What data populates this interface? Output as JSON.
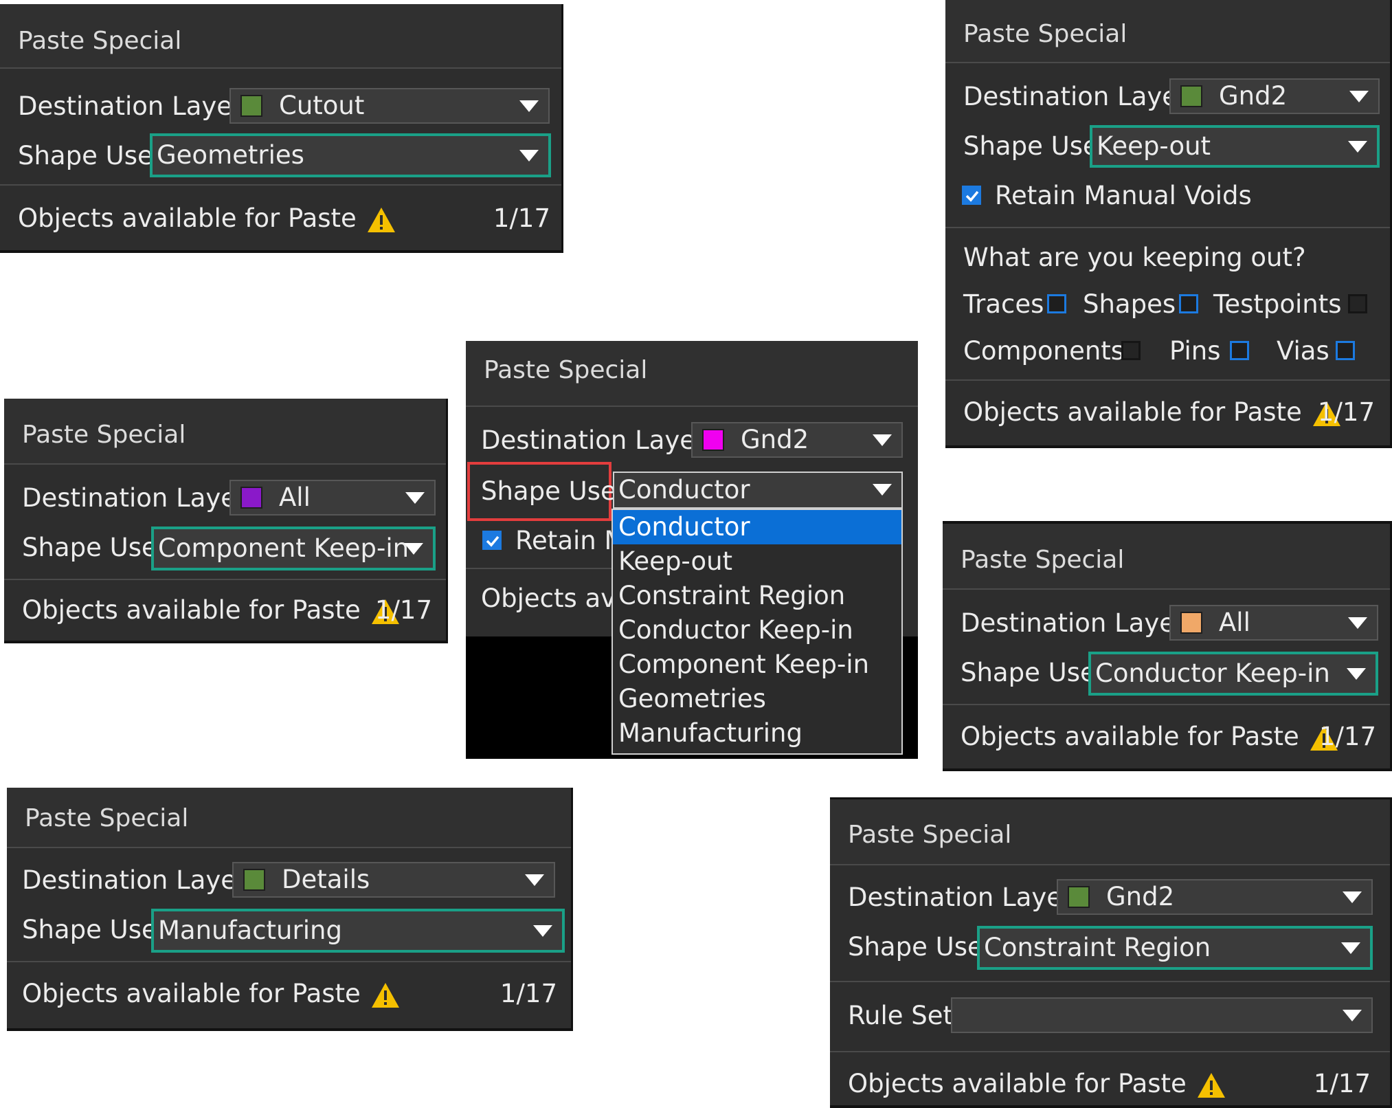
{
  "colors": {
    "highlight_border": "#1aa087",
    "focus_border": "#e33d3d",
    "selected_option_bg": "#0b6fd6",
    "checkbox_blue": "#1c7ae0",
    "warning_yellow": "#f5c000"
  },
  "icons": {
    "warning": "warning-triangle-icon",
    "dropdown": "chevron-down-icon"
  },
  "panels": {
    "p1": {
      "title": "Paste Special",
      "dest_label": "Destination Layer",
      "dest_value": "Cutout",
      "dest_color": "#5a8a3a",
      "shape_label": "Shape Use",
      "shape_value": "Geometries",
      "objects_label": "Objects available for Paste",
      "count": "1/17"
    },
    "p2": {
      "title": "Paste Special",
      "dest_label": "Destination Layer",
      "dest_value": "Gnd2",
      "dest_color": "#5a8a3a",
      "shape_label": "Shape Use",
      "shape_value": "Keep-out",
      "retain_label": "Retain Manual Voids",
      "question": "What are you keeping out?",
      "keepout_options": {
        "traces": "Traces",
        "shapes": "Shapes",
        "testpoints": "Testpoints",
        "components": "Components",
        "pins": "Pins",
        "vias": "Vias"
      },
      "objects_label": "Objects available for Paste",
      "count": "1/17"
    },
    "p3": {
      "title": "Paste Special",
      "dest_label": "Destination Layer",
      "dest_value": "All",
      "dest_color": "#8a19c9",
      "shape_label": "Shape Use",
      "shape_value": "Component Keep-in",
      "objects_label": "Objects available for Paste",
      "count": "1/17"
    },
    "p4": {
      "title": "Paste Special",
      "dest_label": "Destination Layer",
      "dest_value": "Gnd2",
      "dest_color": "#f000f0",
      "shape_label": "Shape Use",
      "shape_value": "Conductor",
      "retain_label_partial": "Retain M",
      "objects_label_partial": "Objects ava",
      "options": [
        "Conductor",
        "Keep-out",
        "Constraint Region",
        "Conductor Keep-in",
        "Component Keep-in",
        "Geometries",
        "Manufacturing"
      ],
      "selected_option": "Conductor"
    },
    "p5": {
      "title": "Paste Special",
      "dest_label": "Destination Layer",
      "dest_value": "All",
      "dest_color": "#f0a868",
      "shape_label": "Shape Use",
      "shape_value": "Conductor Keep-in",
      "objects_label": "Objects available for Paste",
      "count": "1/17"
    },
    "p6": {
      "title": "Paste Special",
      "dest_label": "Destination Layer",
      "dest_value": "Details",
      "dest_color": "#5a8a3a",
      "shape_label": "Shape Use",
      "shape_value": "Manufacturing",
      "objects_label": "Objects available for Paste",
      "count": "1/17"
    },
    "p7": {
      "title": "Paste Special",
      "dest_label": "Destination Layer",
      "dest_value": "Gnd2",
      "dest_color": "#5a8a3a",
      "shape_label": "Shape Use",
      "shape_value": "Constraint Region",
      "rule_label": "Rule Set",
      "rule_value": "",
      "objects_label": "Objects available for Paste",
      "count": "1/17"
    }
  }
}
